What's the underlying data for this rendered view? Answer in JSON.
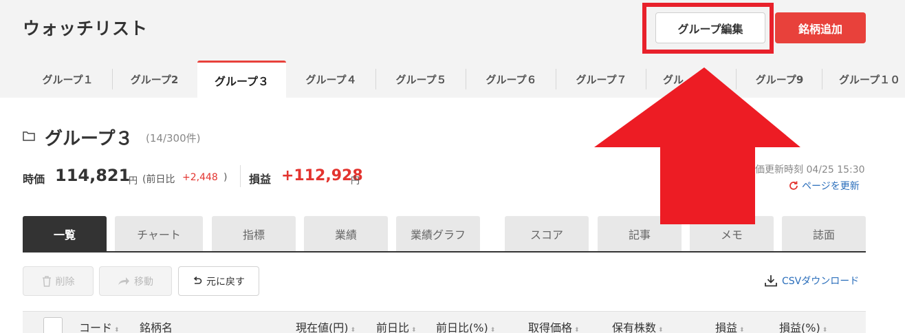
{
  "page": {
    "title": "ウォッチリスト"
  },
  "header_buttons": {
    "edit_group": "グループ編集",
    "add_stock": "銘柄追加"
  },
  "group_tabs": [
    {
      "label": "グループ１",
      "active": false
    },
    {
      "label": "グループ2",
      "active": false
    },
    {
      "label": "グループ３",
      "active": true
    },
    {
      "label": "グループ４",
      "active": false
    },
    {
      "label": "グループ５",
      "active": false
    },
    {
      "label": "グループ６",
      "active": false
    },
    {
      "label": "グループ７",
      "active": false
    },
    {
      "label": "グル",
      "active": false
    },
    {
      "label": "グループ9",
      "active": false
    },
    {
      "label": "グループ１０",
      "active": false
    }
  ],
  "group": {
    "name": "グループ３",
    "count": "(14/300件)"
  },
  "summary": {
    "market_label": "時価",
    "market_value": "114,821",
    "market_unit": "円",
    "prev_label": "(前日比",
    "prev_value": "+2,448",
    "prev_close": ")",
    "pl_label": "損益",
    "pl_value": "+112,928",
    "pl_unit": "円"
  },
  "update": {
    "time_text": "価更新時刻 04/25 15:30",
    "refresh_label": "ページを更新"
  },
  "view_tabs": [
    {
      "label": "一覧",
      "active": true
    },
    {
      "label": "チャート",
      "active": false
    },
    {
      "label": "指標",
      "active": false
    },
    {
      "label": "業績",
      "active": false
    },
    {
      "label": "業績グラフ",
      "active": false
    },
    {
      "label": "スコア",
      "active": false
    },
    {
      "label": "記事",
      "active": false
    },
    {
      "label": "メモ",
      "active": false
    },
    {
      "label": "誌面",
      "active": false
    }
  ],
  "actions": {
    "delete": "削除",
    "move": "移動",
    "undo": "元に戻す",
    "csv": "CSVダウンロード"
  },
  "table_headers": [
    "コード",
    "銘柄名",
    "現在値(円)",
    "前日比",
    "前日比(%)",
    "取得価格",
    "保有株数",
    "損益",
    "損益(%)"
  ],
  "colors": {
    "accent": "#e8413b",
    "highlight": "#e8212b",
    "link": "#2a6ebb",
    "gain": "#e3342f"
  },
  "icons": [
    "folder-icon",
    "refresh-icon",
    "trash-icon",
    "arrow-right-icon",
    "undo-icon",
    "download-icon",
    "sort-icon",
    "red-arrow-up-icon"
  ]
}
